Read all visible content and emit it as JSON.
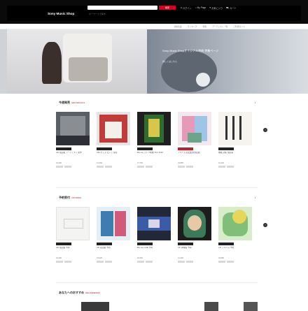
{
  "header": {
    "logo": "Sony Music Shop",
    "search_placeholder": "キーワードで探す",
    "search_button": "検索",
    "links": [
      "ログイン",
      "My Page",
      "お気に入り",
      "カート"
    ]
  },
  "nav": [
    "新着商品",
    "ランキング",
    "特集",
    "アーティスト一覧",
    "ご利用ガイド"
  ],
  "hero": {
    "caption": "Sony Music Shopオリジナル特典 特集ページ",
    "sub": "詳しくはこちら"
  },
  "sections": [
    {
      "title": "今週発売",
      "subtitle": "NEW ARRIVALS",
      "items": [
        {
          "title": "CD 限定盤 アーティスト 新作",
          "price": "¥3,300"
        },
        {
          "title": "CD+グッズ セット 限定",
          "price": "¥4,400"
        },
        {
          "title": "Blu-ray ライブ映像 Tour 2023",
          "price": "¥7,700"
        },
        {
          "title": "アルバム 初回生産限定盤",
          "price": "¥3,850"
        },
        {
          "title": "書籍 詩集 限定版",
          "price": "¥2,200"
        }
      ]
    },
    {
      "title": "予約受付",
      "subtitle": "UPCOMING",
      "items": [
        {
          "title": "CD 限定盤 予約",
          "price": "¥3,300"
        },
        {
          "title": "CD 初回盤 予約",
          "price": "¥3,520"
        },
        {
          "title": "Blu-ray LIVE 予約",
          "price": "¥6,600"
        },
        {
          "title": "CD 通常盤 予約",
          "price": "¥1,320"
        },
        {
          "title": "CD アルバム 予約",
          "price": "¥3,080"
        }
      ]
    }
  ],
  "recommend": {
    "title": "あなたへのおすすめ",
    "subtitle": "RECOMMENDED"
  },
  "colors": {
    "header_bg": "#000000",
    "accent_red": "#c0202a",
    "link_blue": "#4a7ab5"
  }
}
